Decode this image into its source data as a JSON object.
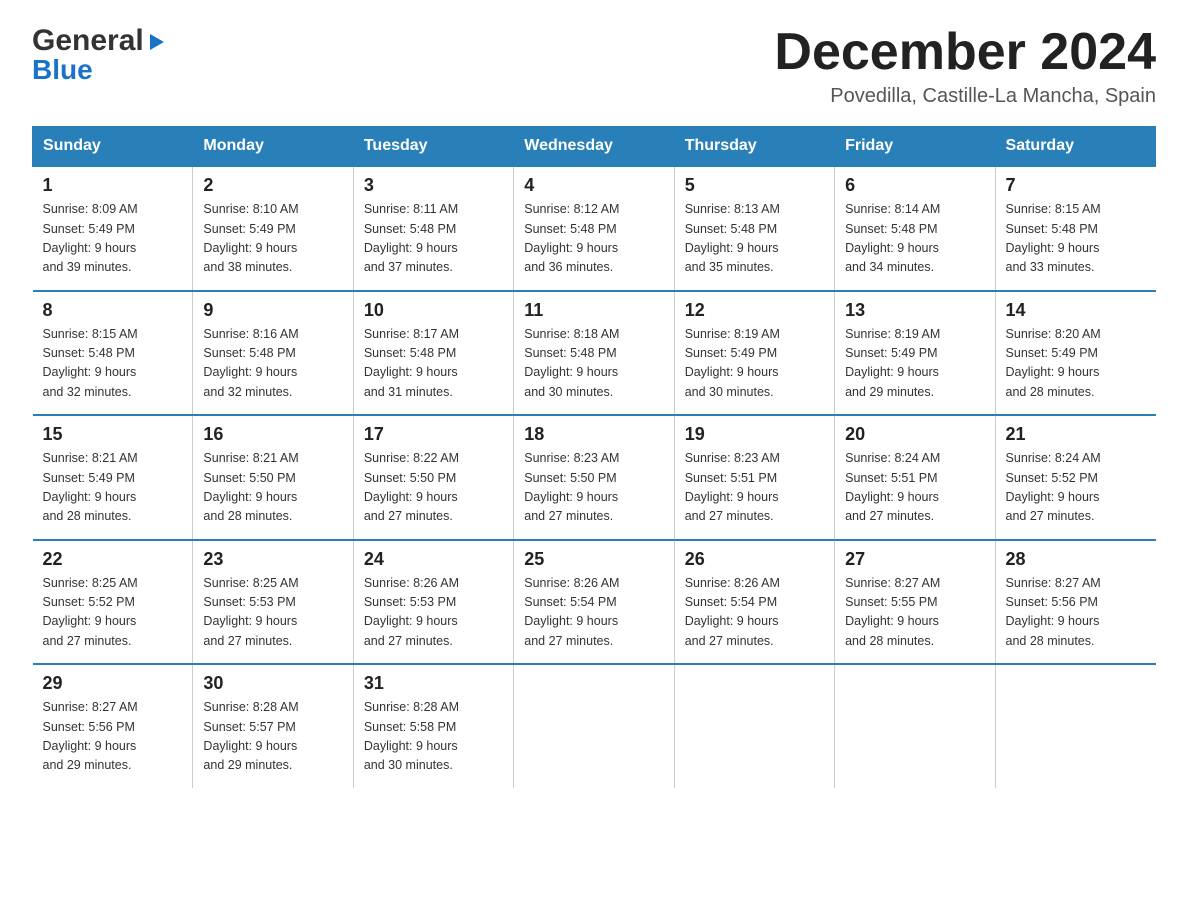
{
  "logo": {
    "part1": "General",
    "arrow": "▶",
    "part2": "Blue"
  },
  "title": "December 2024",
  "location": "Povedilla, Castille-La Mancha, Spain",
  "days_of_week": [
    "Sunday",
    "Monday",
    "Tuesday",
    "Wednesday",
    "Thursday",
    "Friday",
    "Saturday"
  ],
  "weeks": [
    [
      {
        "day": "1",
        "sunrise": "Sunrise: 8:09 AM",
        "sunset": "Sunset: 5:49 PM",
        "daylight": "Daylight: 9 hours and 39 minutes."
      },
      {
        "day": "2",
        "sunrise": "Sunrise: 8:10 AM",
        "sunset": "Sunset: 5:49 PM",
        "daylight": "Daylight: 9 hours and 38 minutes."
      },
      {
        "day": "3",
        "sunrise": "Sunrise: 8:11 AM",
        "sunset": "Sunset: 5:48 PM",
        "daylight": "Daylight: 9 hours and 37 minutes."
      },
      {
        "day": "4",
        "sunrise": "Sunrise: 8:12 AM",
        "sunset": "Sunset: 5:48 PM",
        "daylight": "Daylight: 9 hours and 36 minutes."
      },
      {
        "day": "5",
        "sunrise": "Sunrise: 8:13 AM",
        "sunset": "Sunset: 5:48 PM",
        "daylight": "Daylight: 9 hours and 35 minutes."
      },
      {
        "day": "6",
        "sunrise": "Sunrise: 8:14 AM",
        "sunset": "Sunset: 5:48 PM",
        "daylight": "Daylight: 9 hours and 34 minutes."
      },
      {
        "day": "7",
        "sunrise": "Sunrise: 8:15 AM",
        "sunset": "Sunset: 5:48 PM",
        "daylight": "Daylight: 9 hours and 33 minutes."
      }
    ],
    [
      {
        "day": "8",
        "sunrise": "Sunrise: 8:15 AM",
        "sunset": "Sunset: 5:48 PM",
        "daylight": "Daylight: 9 hours and 32 minutes."
      },
      {
        "day": "9",
        "sunrise": "Sunrise: 8:16 AM",
        "sunset": "Sunset: 5:48 PM",
        "daylight": "Daylight: 9 hours and 32 minutes."
      },
      {
        "day": "10",
        "sunrise": "Sunrise: 8:17 AM",
        "sunset": "Sunset: 5:48 PM",
        "daylight": "Daylight: 9 hours and 31 minutes."
      },
      {
        "day": "11",
        "sunrise": "Sunrise: 8:18 AM",
        "sunset": "Sunset: 5:48 PM",
        "daylight": "Daylight: 9 hours and 30 minutes."
      },
      {
        "day": "12",
        "sunrise": "Sunrise: 8:19 AM",
        "sunset": "Sunset: 5:49 PM",
        "daylight": "Daylight: 9 hours and 30 minutes."
      },
      {
        "day": "13",
        "sunrise": "Sunrise: 8:19 AM",
        "sunset": "Sunset: 5:49 PM",
        "daylight": "Daylight: 9 hours and 29 minutes."
      },
      {
        "day": "14",
        "sunrise": "Sunrise: 8:20 AM",
        "sunset": "Sunset: 5:49 PM",
        "daylight": "Daylight: 9 hours and 28 minutes."
      }
    ],
    [
      {
        "day": "15",
        "sunrise": "Sunrise: 8:21 AM",
        "sunset": "Sunset: 5:49 PM",
        "daylight": "Daylight: 9 hours and 28 minutes."
      },
      {
        "day": "16",
        "sunrise": "Sunrise: 8:21 AM",
        "sunset": "Sunset: 5:50 PM",
        "daylight": "Daylight: 9 hours and 28 minutes."
      },
      {
        "day": "17",
        "sunrise": "Sunrise: 8:22 AM",
        "sunset": "Sunset: 5:50 PM",
        "daylight": "Daylight: 9 hours and 27 minutes."
      },
      {
        "day": "18",
        "sunrise": "Sunrise: 8:23 AM",
        "sunset": "Sunset: 5:50 PM",
        "daylight": "Daylight: 9 hours and 27 minutes."
      },
      {
        "day": "19",
        "sunrise": "Sunrise: 8:23 AM",
        "sunset": "Sunset: 5:51 PM",
        "daylight": "Daylight: 9 hours and 27 minutes."
      },
      {
        "day": "20",
        "sunrise": "Sunrise: 8:24 AM",
        "sunset": "Sunset: 5:51 PM",
        "daylight": "Daylight: 9 hours and 27 minutes."
      },
      {
        "day": "21",
        "sunrise": "Sunrise: 8:24 AM",
        "sunset": "Sunset: 5:52 PM",
        "daylight": "Daylight: 9 hours and 27 minutes."
      }
    ],
    [
      {
        "day": "22",
        "sunrise": "Sunrise: 8:25 AM",
        "sunset": "Sunset: 5:52 PM",
        "daylight": "Daylight: 9 hours and 27 minutes."
      },
      {
        "day": "23",
        "sunrise": "Sunrise: 8:25 AM",
        "sunset": "Sunset: 5:53 PM",
        "daylight": "Daylight: 9 hours and 27 minutes."
      },
      {
        "day": "24",
        "sunrise": "Sunrise: 8:26 AM",
        "sunset": "Sunset: 5:53 PM",
        "daylight": "Daylight: 9 hours and 27 minutes."
      },
      {
        "day": "25",
        "sunrise": "Sunrise: 8:26 AM",
        "sunset": "Sunset: 5:54 PM",
        "daylight": "Daylight: 9 hours and 27 minutes."
      },
      {
        "day": "26",
        "sunrise": "Sunrise: 8:26 AM",
        "sunset": "Sunset: 5:54 PM",
        "daylight": "Daylight: 9 hours and 27 minutes."
      },
      {
        "day": "27",
        "sunrise": "Sunrise: 8:27 AM",
        "sunset": "Sunset: 5:55 PM",
        "daylight": "Daylight: 9 hours and 28 minutes."
      },
      {
        "day": "28",
        "sunrise": "Sunrise: 8:27 AM",
        "sunset": "Sunset: 5:56 PM",
        "daylight": "Daylight: 9 hours and 28 minutes."
      }
    ],
    [
      {
        "day": "29",
        "sunrise": "Sunrise: 8:27 AM",
        "sunset": "Sunset: 5:56 PM",
        "daylight": "Daylight: 9 hours and 29 minutes."
      },
      {
        "day": "30",
        "sunrise": "Sunrise: 8:28 AM",
        "sunset": "Sunset: 5:57 PM",
        "daylight": "Daylight: 9 hours and 29 minutes."
      },
      {
        "day": "31",
        "sunrise": "Sunrise: 8:28 AM",
        "sunset": "Sunset: 5:58 PM",
        "daylight": "Daylight: 9 hours and 30 minutes."
      },
      null,
      null,
      null,
      null
    ]
  ]
}
